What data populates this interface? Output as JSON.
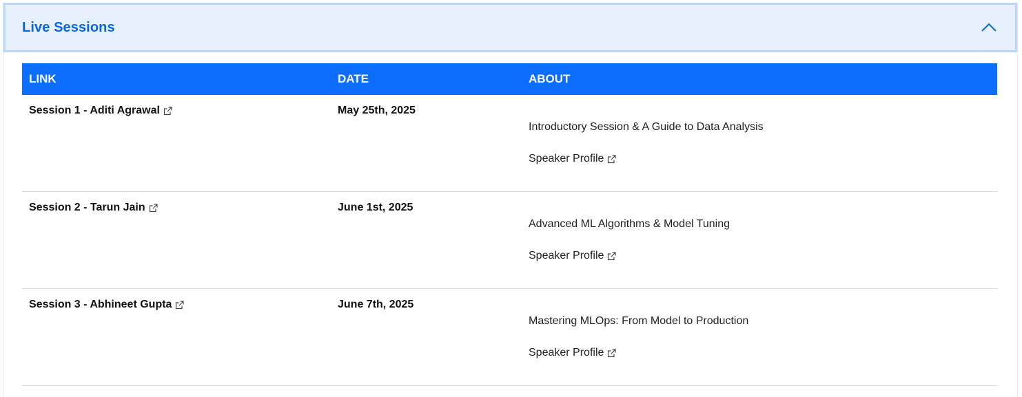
{
  "accordion": {
    "title": "Live Sessions",
    "toggle_icon": "chevron-up-icon",
    "accent_color": "#0d66d8",
    "header_bg": "#e7f1fe"
  },
  "table": {
    "header_bg": "#0d6efd",
    "headers": {
      "link": "LINK",
      "date": "DATE",
      "about": "ABOUT"
    },
    "rows": [
      {
        "session": "Session 1 - Aditi Agrawal",
        "date": "May 25th, 2025",
        "about": "Introductory Session & A Guide to Data Analysis",
        "speaker_link": "Speaker Profile"
      },
      {
        "session": "Session 2 - Tarun Jain",
        "date": "June 1st, 2025",
        "about": "Advanced ML Algorithms & Model Tuning",
        "speaker_link": "Speaker Profile"
      },
      {
        "session": "Session 3 - Abhineet Gupta",
        "date": "June 7th, 2025",
        "about": "Mastering MLOps: From Model to Production",
        "speaker_link": "Speaker Profile"
      }
    ]
  }
}
